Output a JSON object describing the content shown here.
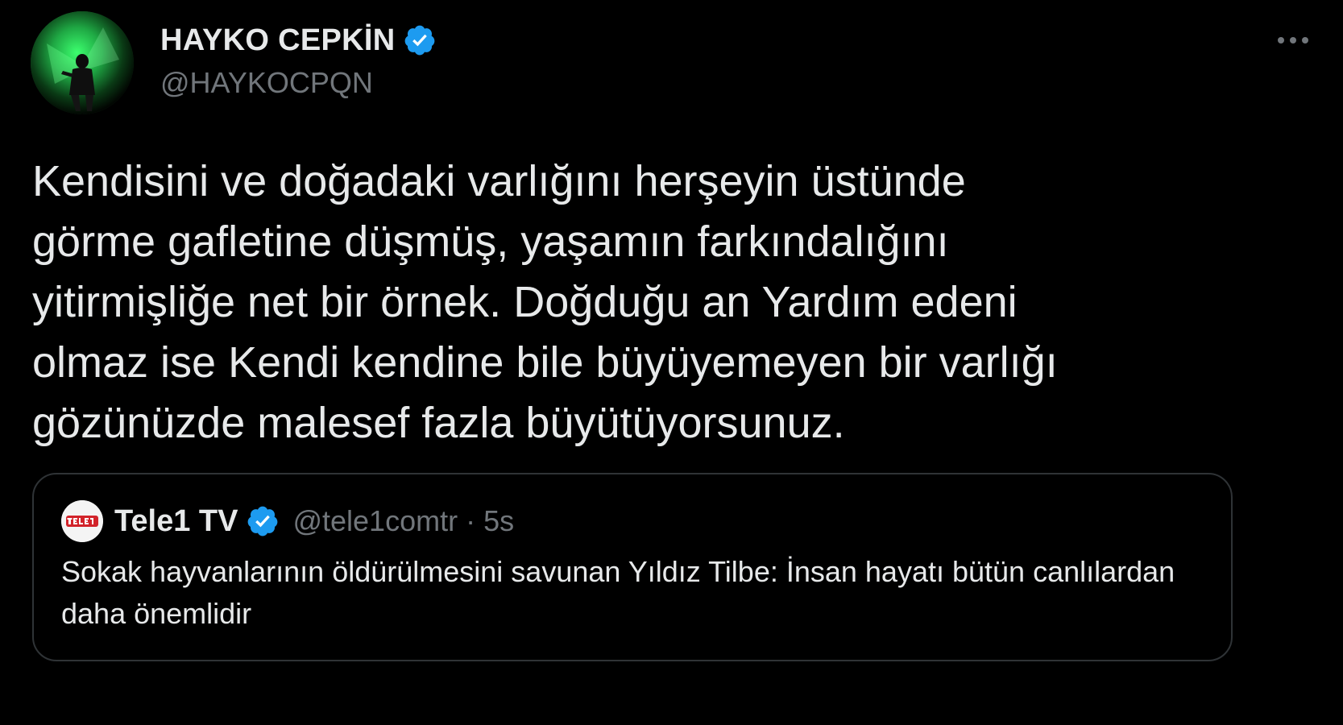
{
  "tweet": {
    "author": {
      "display_name": "HAYKO CEPKİN",
      "handle": "@HAYKOCPQN",
      "verified": true,
      "avatar_icon": "profile-photo"
    },
    "more_icon": "more-dots-icon",
    "text": "Kendisini ve doğadaki varlığını herşeyin üstünde\ngörme gafletine düşmüş, yaşamın farkındalığını\nyitirmişliğe net bir örnek. Doğduğu an Yardım edeni\nolmaz ise Kendi kendine bile büyüyemeyen bir varlığı\ngözünüzde malesef fazla büyütüyorsunuz."
  },
  "quoted": {
    "display_name": "Tele1 TV",
    "handle": "@tele1comtr",
    "separator": "·",
    "time": "5s",
    "verified": true,
    "avatar_icon": "tele1-logo",
    "text": "Sokak hayvanlarının öldürülmesini savunan Yıldız Tilbe: İnsan hayatı bütün canlılardan daha önemlidir"
  },
  "colors": {
    "background": "#000000",
    "primary_text": "#e7e9ea",
    "secondary_text": "#71767b",
    "verified_blue": "#1d9bf0",
    "border": "#2f3336",
    "tele1_red": "#d2232a"
  }
}
